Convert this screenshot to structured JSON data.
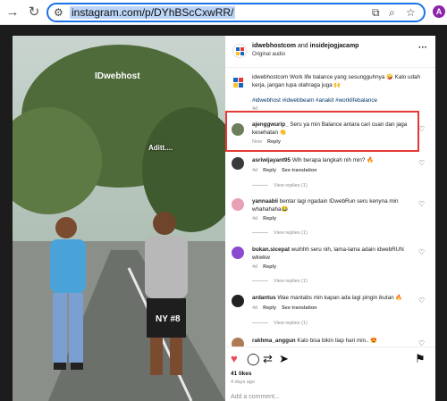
{
  "browser": {
    "url": "instagram.com/p/DYhBScCxwRR/",
    "profile_initial": "A"
  },
  "video": {
    "logo_text": "IDwebhost",
    "caption_overlay": "Aditt...."
  },
  "post": {
    "header": {
      "account_1": "idwebhostcom",
      "joiner": " and ",
      "account_2": "insidejogjacamp",
      "audio": "Original audio"
    },
    "caption": {
      "text": "idwebhostcom Work life balance yang sesungguhnya 🤪 Kalo udah kerja, jangan lupa olahraga juga 🙌",
      "tags": "#idwebhost #idwebbeam #anakit #worklifebalance",
      "time": "4d"
    },
    "comments": [
      {
        "user": "ajenggwurip_",
        "text": "Seru ya min Balance antara cari cuan dan jaga kesehatan 👏",
        "time": "Now",
        "reply": "Reply",
        "translation": "",
        "view_replies": ""
      },
      {
        "user": "asriwijayant95",
        "text": "Wih berapa langkah nih min? 🔥",
        "time": "4d",
        "reply": "Reply",
        "translation": "See translation",
        "view_replies": "View replies (1)"
      },
      {
        "user": "yannaabii",
        "text": "bentar lagi ngadain IDwebRun seru kenyna min whahahaha😂",
        "time": "4d",
        "reply": "Reply",
        "translation": "",
        "view_replies": "View replies (1)"
      },
      {
        "user": "bukan.sicepat",
        "text": "wuihhh seru nih, lama-lama adain idwebRUN wkwkw",
        "time": "4d",
        "reply": "Reply",
        "translation": "",
        "view_replies": "View replies (1)"
      },
      {
        "user": "ardantus",
        "text": "Wae mantabs min kapan ada lagi pingin ikutan 🔥",
        "time": "4d",
        "reply": "Reply",
        "translation": "See translation",
        "view_replies": "View replies (1)"
      },
      {
        "user": "rakhma_anggun",
        "text": "Kalo bisa bikin tiap hari min.. 😍",
        "time": "",
        "reply": "",
        "translation": "",
        "view_replies": ""
      }
    ],
    "likes": "41 likes",
    "posted": "4 days ago",
    "add_comment_placeholder": "Add a comment..."
  },
  "colors": {
    "highlight_border": "#e53935",
    "link_blue": "#00376b",
    "address_focus": "#1a73e8",
    "like_red": "#ed4956"
  },
  "icons": [
    "back-icon",
    "reload-icon",
    "tune-icon",
    "install-icon",
    "zoom-icon",
    "bookmark-star-icon",
    "more-icon",
    "heart-icon",
    "comment-icon",
    "repost-icon",
    "share-icon",
    "save-icon"
  ]
}
